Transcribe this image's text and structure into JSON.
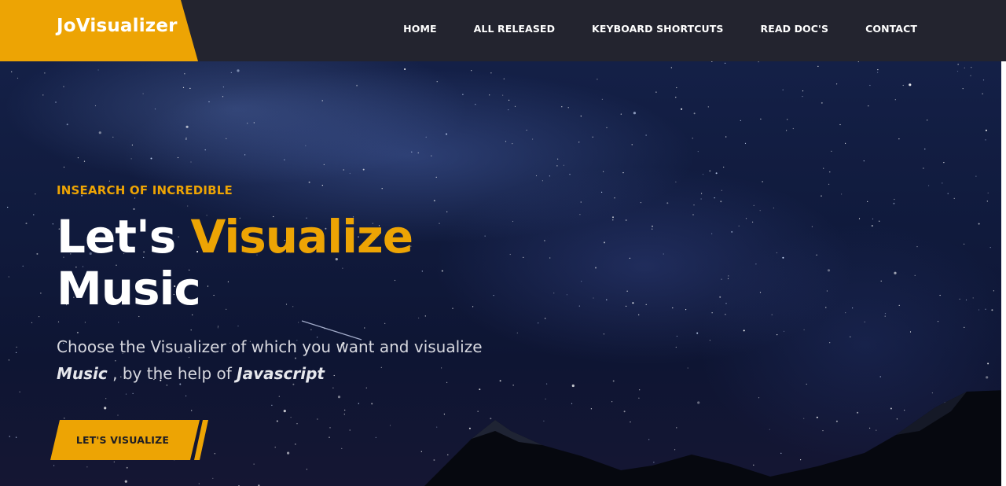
{
  "brand": {
    "name": "JoVisualizer"
  },
  "nav": {
    "items": [
      {
        "label": "HOME"
      },
      {
        "label": "ALL RELEASED"
      },
      {
        "label": "KEYBOARD SHORTCUTS"
      },
      {
        "label": "READ DOC'S"
      },
      {
        "label": "CONTACT"
      }
    ]
  },
  "hero": {
    "eyebrow": "INSEARCH OF INCREDIBLE",
    "title_part1": "Let's ",
    "title_accent": "Visualize",
    "title_part2": "Music",
    "subtitle_part1": "Choose the Visualizer of which you want and visualize ",
    "subtitle_em1": "Music",
    "subtitle_part2": " , by the help of ",
    "subtitle_em2": "Javascript",
    "cta_label": "LET'S VISUALIZE"
  },
  "colors": {
    "accent": "#eda404",
    "header_bg": "#23242f",
    "text_light": "#ffffff"
  }
}
